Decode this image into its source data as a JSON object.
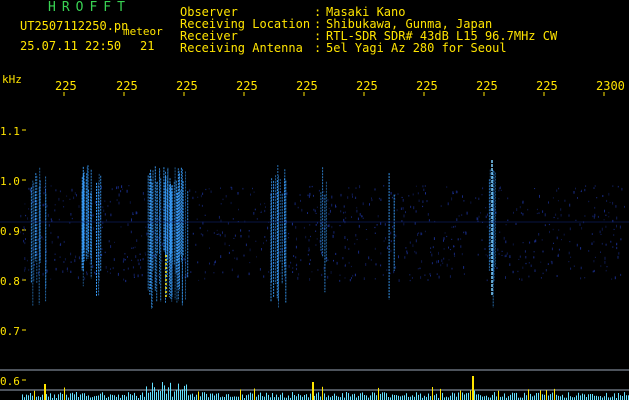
{
  "header": {
    "program": "HROFFT",
    "filename": "UT2507112250.pn",
    "tag": "meteor",
    "datetime": "25.07.11 22:50",
    "count": "21"
  },
  "metadata": [
    {
      "label": "Observer",
      "value": "Masaki Kano"
    },
    {
      "label": "Receiving Location",
      "value": "Shibukawa, Gunma, Japan"
    },
    {
      "label": "Receiver",
      "value": "RTL-SDR SDR# 43dB L15 96.7MHz CW"
    },
    {
      "label": "Receiving Antenna",
      "value": "5el Yagi Az 280 for Seoul"
    }
  ],
  "axes": {
    "y_unit": "kHz",
    "x_ticks": [
      "225",
      "225",
      "225",
      "225",
      "225",
      "225",
      "225",
      "225",
      "225",
      "2300"
    ],
    "y_ticks": [
      "1.1",
      "1.0",
      "0.9",
      "0.8",
      "0.7",
      "0.6"
    ]
  },
  "colors": {
    "text": "#ffe400",
    "title": "#39d353",
    "noise": "#1a2f8f",
    "trace": "#3aa0ff",
    "bar": "#66e0ff",
    "peak": "#ffe400"
  }
}
